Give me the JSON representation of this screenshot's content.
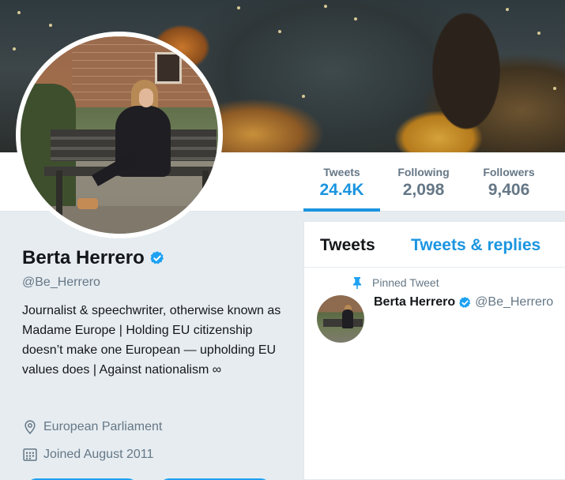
{
  "profile": {
    "name": "Berta Herrero",
    "handle": "@Be_Herrero",
    "bio": "Journalist & speechwriter, otherwise known as Madame Europe | Holding EU citizenship doesn’t make one European — upholding EU values does | Against nationalism ∞",
    "location": "European Parliament",
    "joined": "Joined August 2011",
    "location_icon": "map-pin-icon",
    "joined_icon": "calendar-icon",
    "verified_icon": "verified-badge-icon"
  },
  "nav": {
    "items": [
      {
        "label": "Tweets",
        "value": "24.4K",
        "active": true
      },
      {
        "label": "Following",
        "value": "2,098",
        "active": false
      },
      {
        "label": "Followers",
        "value": "9,406",
        "active": false
      }
    ]
  },
  "timeline": {
    "tabs": [
      {
        "label": "Tweets",
        "active": true
      },
      {
        "label": "Tweets & replies",
        "active": false
      }
    ],
    "pinned_label": "Pinned Tweet",
    "tweet": {
      "name": "Berta Herrero",
      "handle": "@Be_Herrero"
    }
  },
  "colors": {
    "accent": "#1b95e0",
    "verified": "#1da1f2",
    "text_primary": "#14171a",
    "text_secondary": "#657786",
    "page_bg": "#e6ecf0"
  }
}
